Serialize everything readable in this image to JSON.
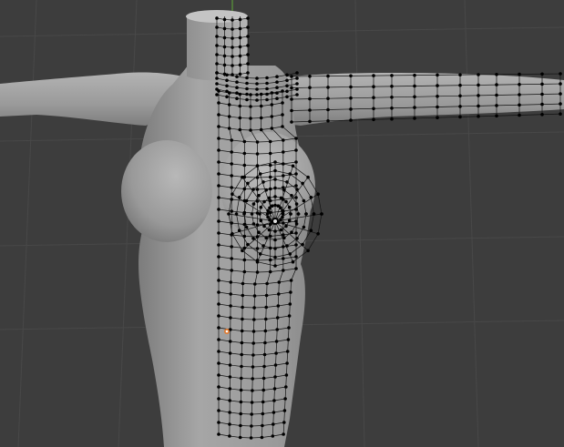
{
  "viewport": {
    "mode": "edit",
    "object": "mesh-body",
    "background_color": "#3d3d3d",
    "grid_color": "#484848",
    "axis_green_color": "#5a9a3a",
    "mesh_fill_color": "#9b9b9b",
    "vertex_color": "#000000",
    "edge_color": "#111111",
    "cursor_color": "#e07a30"
  }
}
